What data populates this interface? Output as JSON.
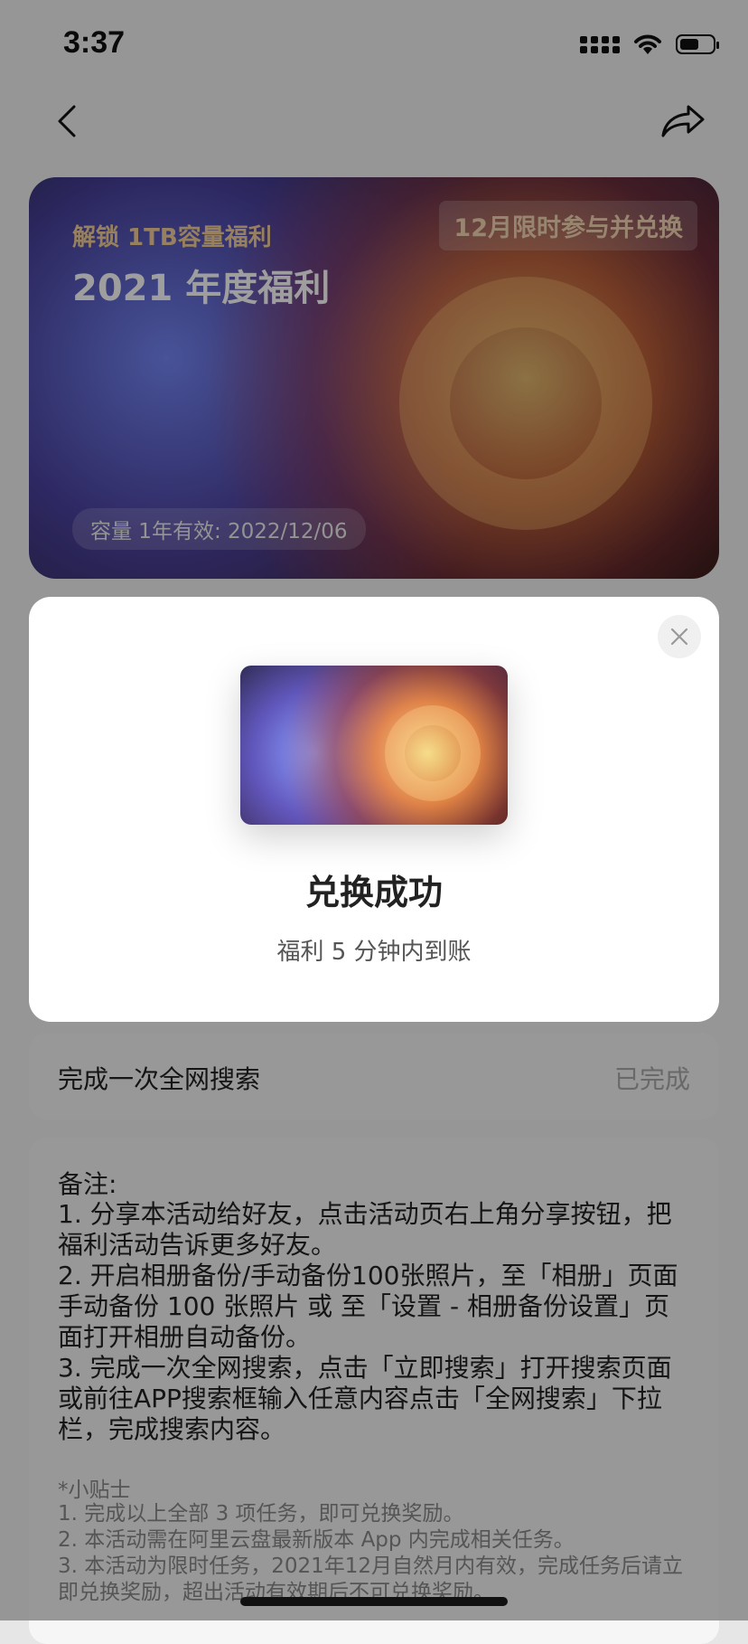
{
  "status_bar": {
    "time": "3:37",
    "battery_level": 0.6
  },
  "hero": {
    "unlock_label": "解锁 1TB容量福利",
    "title": "2021 年度福利",
    "promo_label": "12月限时参与并兑换",
    "validity": "容量 1年有效: 2022/12/06"
  },
  "modal": {
    "title": "兑换成功",
    "subtitle": "福利 5 分钟内到账"
  },
  "task": {
    "label": "完成一次全网搜索",
    "state": "已完成"
  },
  "notes": {
    "head": "备注:",
    "items": [
      "1. 分享本活动给好友，点击活动页右上角分享按钮，把福利活动告诉更多好友。",
      "2. 开启相册备份/手动备份100张照片，至「相册」页面手动备份 100 张照片 或 至「设置 - 相册备份设置」页面打开相册自动备份。",
      "3. 完成一次全网搜索，点击「立即搜索」打开搜索页面或前往APP搜索框输入任意内容点击「全网搜索」下拉栏，完成搜索内容。"
    ],
    "tips_head": "*小贴士",
    "tips": [
      "1. 完成以上全部 3 项任务，即可兑换奖励。",
      "2. 本活动需在阿里云盘最新版本 App 内完成相关任务。",
      "3. 本活动为限时任务，2021年12月自然月内有效，完成任务后请立即兑换奖励，超出活动有效期后不可兑换奖励。"
    ]
  }
}
